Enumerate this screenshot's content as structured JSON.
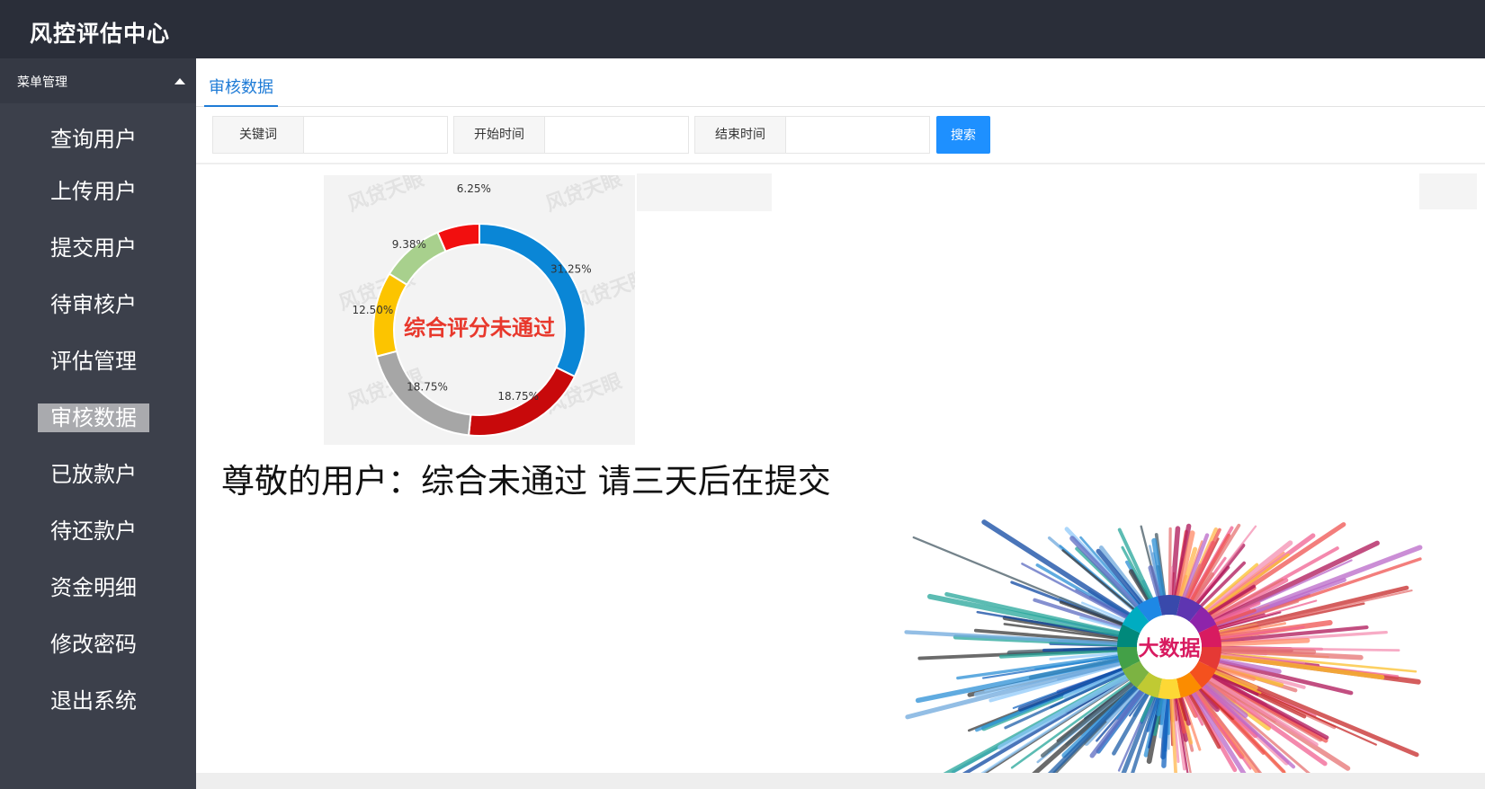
{
  "header": {
    "app_title": "风控评估中心"
  },
  "sidebar": {
    "menu_header": "菜单管理",
    "items": [
      {
        "label": "查询用户",
        "active": false
      },
      {
        "label": "上传用户",
        "active": false
      },
      {
        "label": "提交用户",
        "active": false
      },
      {
        "label": "待审核户",
        "active": false
      },
      {
        "label": "评估管理",
        "active": false
      },
      {
        "label": "审核数据",
        "active": true
      },
      {
        "label": "已放款户",
        "active": false
      },
      {
        "label": "待还款户",
        "active": false
      },
      {
        "label": "资金明细",
        "active": false
      },
      {
        "label": "修改密码",
        "active": false
      },
      {
        "label": "退出系统",
        "active": false
      }
    ]
  },
  "main": {
    "tab_label": "审核数据",
    "search": {
      "keyword_label": "关键词",
      "keyword_value": "",
      "start_label": "开始时间",
      "start_value": "",
      "end_label": "结束时间",
      "end_value": "",
      "button_label": "搜索"
    },
    "notice": "尊敬的用户：综合未通过 请三天后在提交",
    "donut": {
      "center_text": "综合评分未通过",
      "watermark": "风贷天眼",
      "slices": [
        {
          "label": "31.25%",
          "value": 31.25,
          "color": "#0a86d6"
        },
        {
          "label": "18.75%",
          "value": 18.75,
          "color": "#c8090b"
        },
        {
          "label": "18.75%",
          "value": 18.75,
          "color": "#a6a6a6"
        },
        {
          "label": "12.50%",
          "value": 12.5,
          "color": "#fcc400"
        },
        {
          "label": "9.38%",
          "value": 9.38,
          "color": "#a8d08d"
        },
        {
          "label": "6.25%",
          "value": 6.25,
          "color": "#f20f0f"
        }
      ]
    },
    "bigdata": {
      "center_text": "大数据",
      "wheel_colors": [
        "#e53935",
        "#f4511e",
        "#fb8c00",
        "#fdd835",
        "#c0ca33",
        "#7cb342",
        "#43a047",
        "#00897b",
        "#00acc1",
        "#1e88e5",
        "#3949ab",
        "#5e35b1",
        "#8e24aa",
        "#d81b60"
      ]
    }
  }
}
